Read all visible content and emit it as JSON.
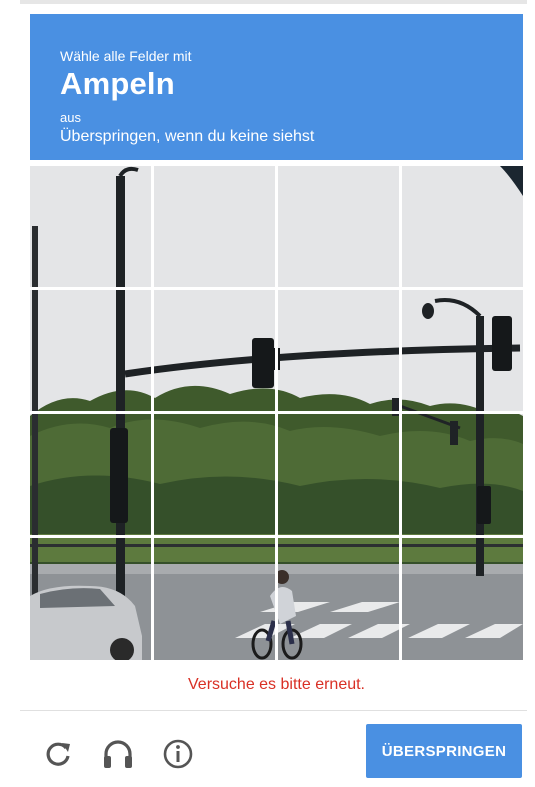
{
  "header": {
    "instruction": "Wähle alle Felder mit",
    "object": "Ampeln",
    "aus": "aus",
    "skip_hint": "Überspringen, wenn du keine siehst"
  },
  "grid": {
    "rows": 4,
    "cols": 4
  },
  "error_message": "Versuche es bitte erneut.",
  "footer": {
    "reload_icon": "reload-icon",
    "audio_icon": "headphones-icon",
    "info_icon": "info-icon",
    "skip_button": "ÜBERSPRINGEN"
  },
  "colors": {
    "accent": "#4a90e2",
    "error": "#d93025"
  }
}
